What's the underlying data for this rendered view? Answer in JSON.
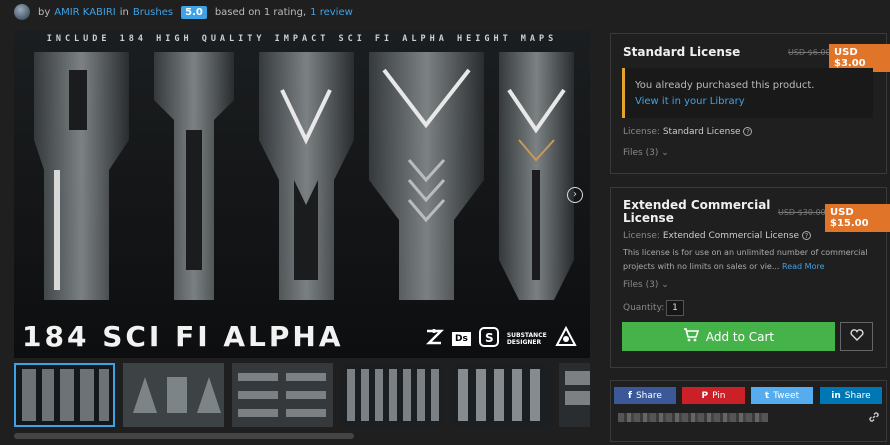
{
  "header": {
    "by": "by",
    "author": "AMIR KABIRI",
    "in": "in",
    "category": "Brushes",
    "score": "5.0",
    "rating_text": "based on 1 rating,",
    "review_link": "1 review"
  },
  "hero": {
    "top_caption": "INCLUDE 184 HIGH QUALITY IMPACT SCI FI ALPHA HEIGHT MAPS",
    "title": "184 SCI FI ALPHA",
    "logo_ds": "Ds",
    "logo_substance_1": "SUBSTANCE",
    "logo_substance_2": "DESIGNER",
    "next_arrow": "›"
  },
  "standard": {
    "title": "Standard License",
    "old_price": "USD $6.00",
    "price": "USD $3.00",
    "notice": "You already purchased this product.",
    "library_link": "View it in your Library",
    "license_label": "License:",
    "license_value": "Standard License",
    "files": "Files (3)"
  },
  "extended": {
    "title_1": "Extended Commercial",
    "title_2": "License",
    "old_price": "USD $30.00",
    "price": "USD $15.00",
    "license_label": "License:",
    "license_value": "Extended Commercial License",
    "desc_1": "This license is for use on an unlimited number of commercial",
    "desc_2": "projects with no limits on sales or vie...",
    "read_more": "Read More",
    "files": "Files (3)",
    "quantity_label": "Quantity:",
    "quantity": "1",
    "add_to_cart": "Add to Cart"
  },
  "share": {
    "facebook": "Share",
    "pinterest": "Pin",
    "twitter": "Tweet",
    "linkedin": "Share"
  },
  "colors": {
    "accent": "#3fa2e6",
    "price": "#e0752a",
    "cart": "#46b24a",
    "facebook": "#3b5998",
    "pinterest": "#cb2027",
    "twitter": "#55acee",
    "linkedin": "#0077b5"
  }
}
